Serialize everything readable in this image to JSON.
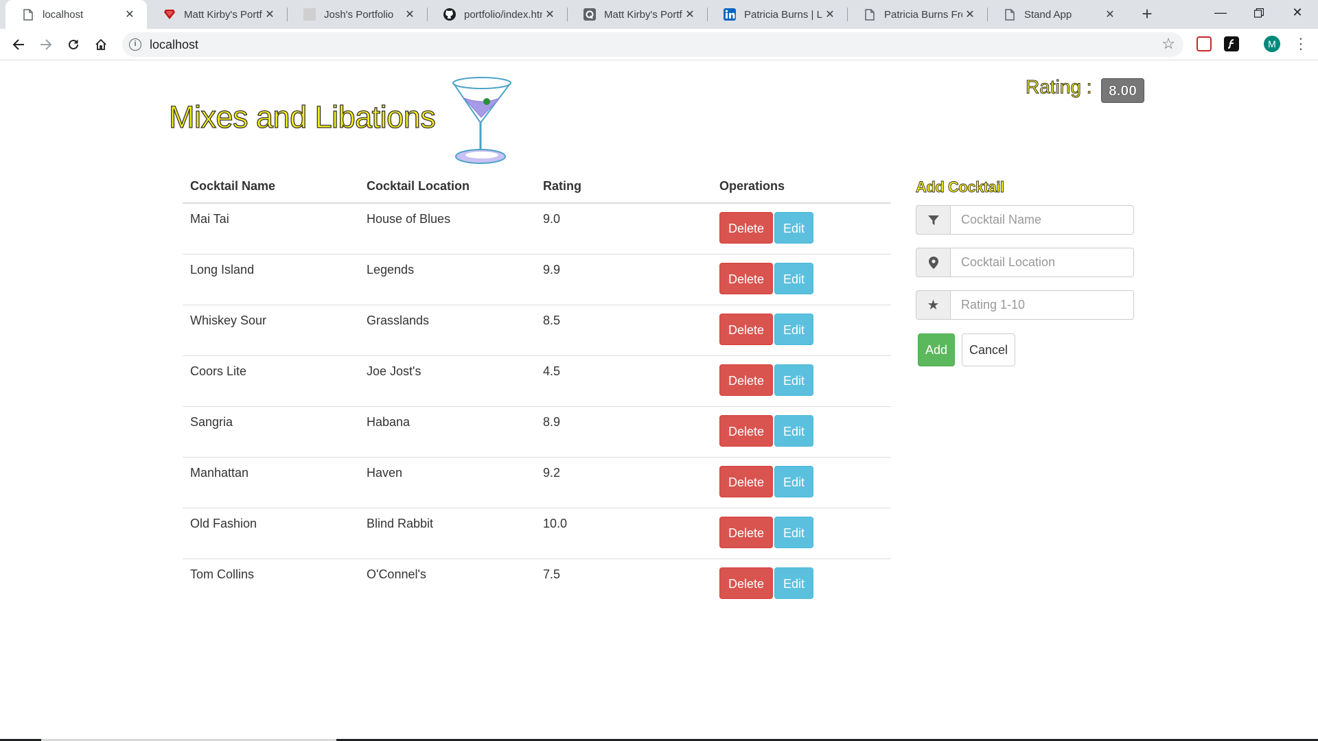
{
  "browser": {
    "tabs": [
      {
        "title": "localhost",
        "icon": "document-icon",
        "active": true
      },
      {
        "title": "Matt Kirby's Portfo",
        "icon": "ruby-icon"
      },
      {
        "title": "Josh's Portfolio",
        "icon": "blank-page-icon"
      },
      {
        "title": "portfolio/index.htm",
        "icon": "github-icon"
      },
      {
        "title": "Matt Kirby's Portfo",
        "icon": "q-logo-icon"
      },
      {
        "title": "Patricia Burns | Link",
        "icon": "linkedin-icon"
      },
      {
        "title": "Patricia Burns Fron",
        "icon": "document-icon"
      },
      {
        "title": "Stand App",
        "icon": "document-icon"
      }
    ],
    "url": "localhost",
    "profile_initial": "M"
  },
  "app": {
    "title": "Mixes and Libations",
    "rating_label": "Rating :",
    "rating_value": "8.00"
  },
  "table": {
    "headers": [
      "Cocktail Name",
      "Cocktail Location",
      "Rating",
      "Operations"
    ],
    "rows": [
      {
        "name": "Mai Tai",
        "location": "House of Blues",
        "rating": "9.0"
      },
      {
        "name": "Long Island",
        "location": "Legends",
        "rating": "9.9"
      },
      {
        "name": "Whiskey Sour",
        "location": "Grasslands",
        "rating": "8.5"
      },
      {
        "name": "Coors Lite",
        "location": "Joe Jost's",
        "rating": "4.5"
      },
      {
        "name": "Sangria",
        "location": "Habana",
        "rating": "8.9"
      },
      {
        "name": "Manhattan",
        "location": "Haven",
        "rating": "9.2"
      },
      {
        "name": "Old Fashion",
        "location": "Blind Rabbit",
        "rating": "10.0"
      },
      {
        "name": "Tom Collins",
        "location": "O'Connel's",
        "rating": "7.5"
      }
    ],
    "delete_label": "Delete",
    "edit_label": "Edit"
  },
  "form": {
    "heading": "Add Cocktail",
    "name_placeholder": "Cocktail Name",
    "location_placeholder": "Cocktail Location",
    "rating_placeholder": "Rating 1-10",
    "add_label": "Add",
    "cancel_label": "Cancel"
  },
  "colors": {
    "title_yellow": "#f7f01c",
    "danger": "#d9534f",
    "info": "#5bc0de",
    "success": "#5cb85c",
    "badge": "#777777"
  }
}
